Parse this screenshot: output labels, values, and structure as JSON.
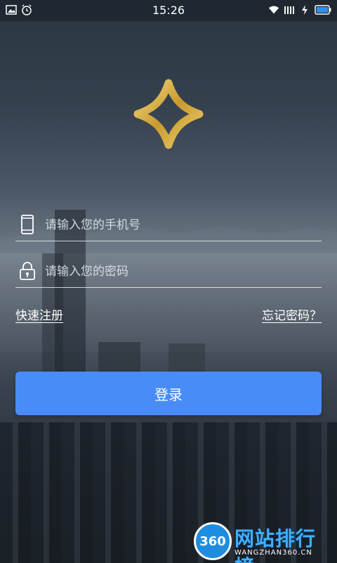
{
  "status_bar": {
    "time": "15:26",
    "left_icons": [
      "image-icon",
      "alarm-icon"
    ],
    "right_icons": [
      "wifi-icon",
      "signal-icon",
      "charging-icon",
      "battery-icon"
    ]
  },
  "logo": {
    "icon": "star-logo-icon",
    "color": "#d6b24e"
  },
  "form": {
    "phone": {
      "placeholder": "请输入您的手机号",
      "value": "",
      "icon": "phone-icon"
    },
    "password": {
      "placeholder": "请输入您的密码",
      "value": "",
      "icon": "lock-icon"
    },
    "register_link": "快速注册",
    "forgot_link": "忘记密码？",
    "login_button": "登录"
  },
  "colors": {
    "accent": "#4a8cf6"
  },
  "watermark": {
    "badge": "360",
    "title": "网站排行榜",
    "subtitle": "WANGZHAN360.CN"
  }
}
